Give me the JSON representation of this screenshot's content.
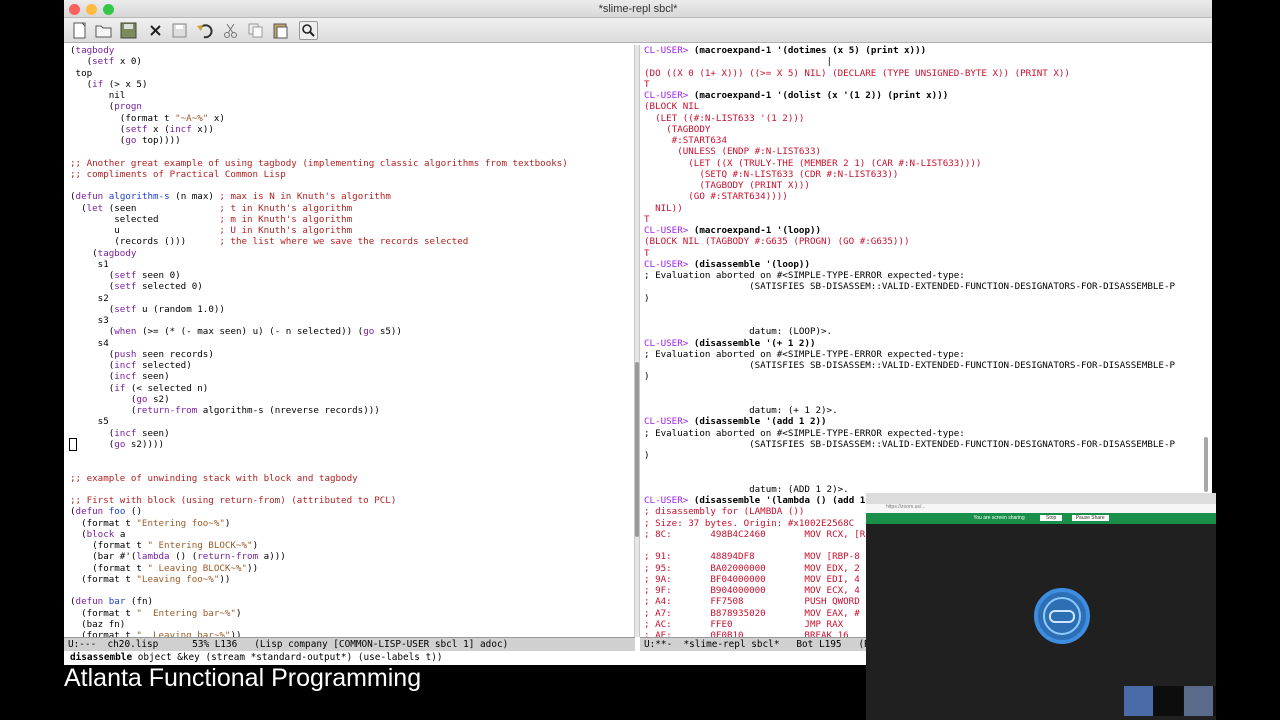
{
  "window": {
    "title": "*slime-repl sbcl*"
  },
  "toolbar": {
    "icons": [
      "new-file-icon",
      "open-folder-icon",
      "save-disk-icon",
      "close-icon",
      "save-icon",
      "undo-icon",
      "cut-icon",
      "copy-icon",
      "paste-icon",
      "search-icon"
    ]
  },
  "left_mode_line": "U:---  ch20.lisp      53% L136   (Lisp company [COMMON-LISP-USER sbcl 1] adoc)",
  "right_mode_line": "U:**-  *slime-repl sbcl*   Bot L195   (R",
  "echo_area": {
    "fn": "disassemble",
    "rest": " object &key (stream *standard-output*) (use-labels t))"
  },
  "caption": "Atlanta Functional Programming",
  "zoom_overlay": {
    "share_text": "You are screen sharing",
    "button1": "Stop",
    "button2": "Pause Share",
    "url": "https://zoom.us/..."
  },
  "colors": {
    "comment": "#b22222",
    "keyword": "#7b1fa2",
    "function": "#1c3fd0",
    "string": "#9a5c2a",
    "repl_output": "#c8102e"
  }
}
